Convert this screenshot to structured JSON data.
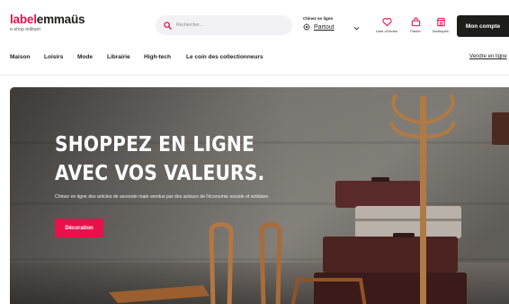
{
  "header": {
    "logo": {
      "part1": "label",
      "part2": "emmaüs",
      "tagline": "e-shop militant"
    },
    "search": {
      "placeholder": "Rechercher..."
    },
    "location": {
      "label": "Chinez en ligne",
      "value": "Partout"
    },
    "icons": [
      {
        "icon": "heart-icon",
        "label": "Liste d'envies"
      },
      {
        "icon": "basket-icon",
        "label": "Panier"
      },
      {
        "icon": "shop-icon",
        "label": "Boutiques"
      }
    ],
    "account_label": "Mon compte"
  },
  "nav": {
    "items": [
      "Maison",
      "Loisirs",
      "Mode",
      "Librairie",
      "High-tech",
      "Le coin des collectionneurs"
    ],
    "sell_label": "Vendre en ligne"
  },
  "hero": {
    "title_line1": "SHOPPEZ EN LIGNE",
    "title_line2": "AVEC VOS VALEURS.",
    "subtitle": "Chinez en ligne des articles de seconde main vendus par des acteurs de l'économie sociale et solidaire.",
    "button_label": "Décoration"
  },
  "colors": {
    "brand": "#e8114c",
    "dark": "#1d1d1b"
  }
}
